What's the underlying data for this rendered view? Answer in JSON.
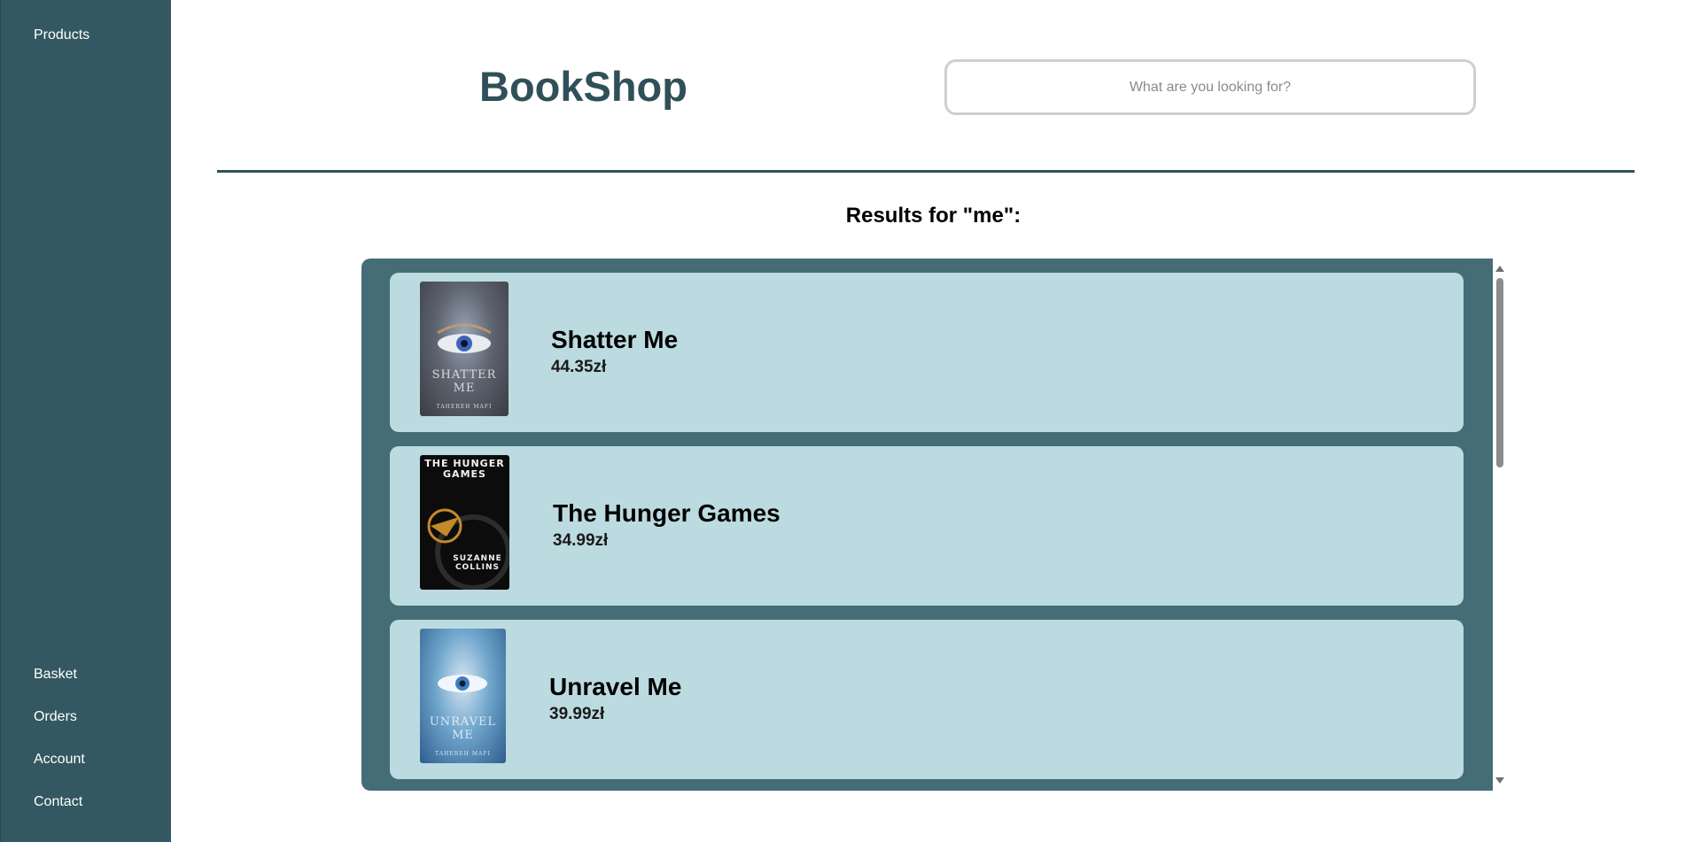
{
  "sidebar": {
    "top_items": [
      {
        "label": "Products"
      }
    ],
    "bottom_items": [
      {
        "label": "Basket"
      },
      {
        "label": "Orders"
      },
      {
        "label": "Account"
      },
      {
        "label": "Contact"
      }
    ]
  },
  "header": {
    "brand": "BookShop",
    "search": {
      "placeholder": "What are you looking for?",
      "value": ""
    }
  },
  "results": {
    "heading": "Results for \"me\":",
    "items": [
      {
        "title": "Shatter Me",
        "price": "44.35zł",
        "cover_title": "SHATTER ME",
        "cover_author": "TAHEREH MAFI"
      },
      {
        "title": "The Hunger Games",
        "price": "34.99zł",
        "cover_title": "THE HUNGER GAMES",
        "cover_author": "SUZANNE COLLINS"
      },
      {
        "title": "Unravel Me",
        "price": "39.99zł",
        "cover_title": "UNRAVEL ME",
        "cover_author": "TAHEREH MAFI"
      }
    ]
  },
  "colors": {
    "sidebar": "#335861",
    "brand": "#2f5059",
    "panel": "#446d75",
    "card": "#bbdbe0"
  }
}
